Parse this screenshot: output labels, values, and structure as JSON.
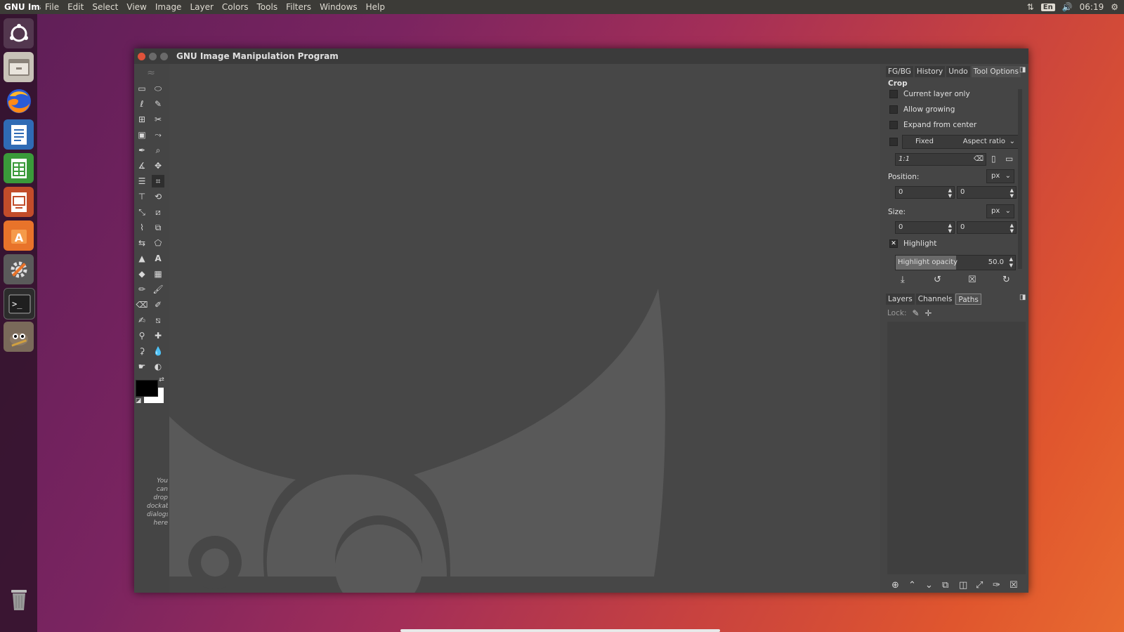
{
  "topbar": {
    "app_name": "GNU Image Manipulation Program",
    "menus": [
      "File",
      "Edit",
      "Select",
      "View",
      "Image",
      "Layer",
      "Colors",
      "Tools",
      "Filters",
      "Windows",
      "Help"
    ],
    "keyboard": "En",
    "time": "06:19"
  },
  "window": {
    "title": "GNU Image Manipulation Program"
  },
  "drop_hint": [
    "You",
    "can",
    "drop",
    "dockable",
    "dialogs",
    "here"
  ],
  "tool_options": {
    "tabs": [
      "FG/BG",
      "History",
      "Undo",
      "Tool Options"
    ],
    "active_tab": "Tool Options",
    "tool_name": "Crop",
    "current_layer_only": "Current layer only",
    "allow_growing": "Allow growing",
    "expand_from_center": "Expand from center",
    "fixed": "Fixed",
    "fixed_mode": "Aspect ratio",
    "ratio_value": "1:1",
    "position_label": "Position:",
    "position_unit": "px",
    "position_x": "0",
    "position_y": "0",
    "size_label": "Size:",
    "size_unit": "px",
    "size_w": "0",
    "size_h": "0",
    "highlight": "Highlight",
    "highlight_opacity_label": "Highlight opacity",
    "highlight_opacity_value": "50.0"
  },
  "layers": {
    "tabs": [
      "Layers",
      "Channels",
      "Paths"
    ],
    "active_tab": "Paths",
    "lock_label": "Lock:"
  }
}
